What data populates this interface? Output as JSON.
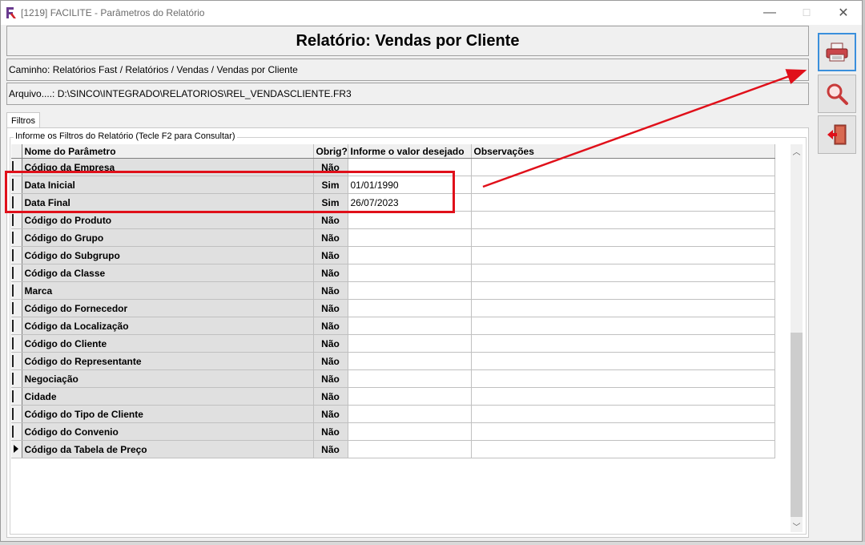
{
  "window": {
    "title": "[1219] FACILITE - Parâmetros do Relatório",
    "minimize_glyph": "—",
    "maximize_glyph": "☐",
    "close_glyph": "✕"
  },
  "header": {
    "report_title": "Relatório: Vendas por Cliente",
    "path": "Caminho: Relatórios Fast / Relatórios / Vendas / Vendas por Cliente",
    "file": "Arquivo....: D:\\SINCO\\INTEGRADO\\RELATORIOS\\REL_VENDASCLIENTE.FR3"
  },
  "tabs": [
    {
      "label": "Filtros"
    }
  ],
  "filters": {
    "caption": "Informe os Filtros do Relatório (Tecle F2 para Consultar)",
    "columns": [
      "Nome do Parâmetro",
      "Obrig?",
      "Informe o valor desejado",
      "Observações"
    ],
    "rows": [
      {
        "name": "Código da Empresa",
        "obrig": "Não",
        "value": "",
        "obs": ""
      },
      {
        "name": "Data Inicial",
        "obrig": "Sim",
        "value": "01/01/1990",
        "obs": ""
      },
      {
        "name": "Data Final",
        "obrig": "Sim",
        "value": "26/07/2023",
        "obs": ""
      },
      {
        "name": "Código do Produto",
        "obrig": "Não",
        "value": "",
        "obs": ""
      },
      {
        "name": "Código do Grupo",
        "obrig": "Não",
        "value": "",
        "obs": ""
      },
      {
        "name": "Código do Subgrupo",
        "obrig": "Não",
        "value": "",
        "obs": ""
      },
      {
        "name": "Código da Classe",
        "obrig": "Não",
        "value": "",
        "obs": ""
      },
      {
        "name": "Marca",
        "obrig": "Não",
        "value": "",
        "obs": ""
      },
      {
        "name": "Código do Fornecedor",
        "obrig": "Não",
        "value": "",
        "obs": ""
      },
      {
        "name": "Código da Localização",
        "obrig": "Não",
        "value": "",
        "obs": ""
      },
      {
        "name": "Código do Cliente",
        "obrig": "Não",
        "value": "",
        "obs": ""
      },
      {
        "name": "Código do Representante",
        "obrig": "Não",
        "value": "",
        "obs": ""
      },
      {
        "name": "Negociação",
        "obrig": "Não",
        "value": "",
        "obs": ""
      },
      {
        "name": "Cidade",
        "obrig": "Não",
        "value": "",
        "obs": ""
      },
      {
        "name": "Código do Tipo de Cliente",
        "obrig": "Não",
        "value": "",
        "obs": ""
      },
      {
        "name": "Código do Convenio",
        "obrig": "Não",
        "value": "",
        "obs": ""
      },
      {
        "name": "Código da Tabela de Preço",
        "obrig": "Não",
        "value": "",
        "obs": ""
      }
    ],
    "current_row_index": 16
  },
  "toolbar": {
    "buttons": [
      {
        "icon": "printer-icon"
      },
      {
        "icon": "magnifier-icon"
      },
      {
        "icon": "exit-door-icon"
      }
    ]
  },
  "annotation": {
    "color": "#e0101a"
  }
}
